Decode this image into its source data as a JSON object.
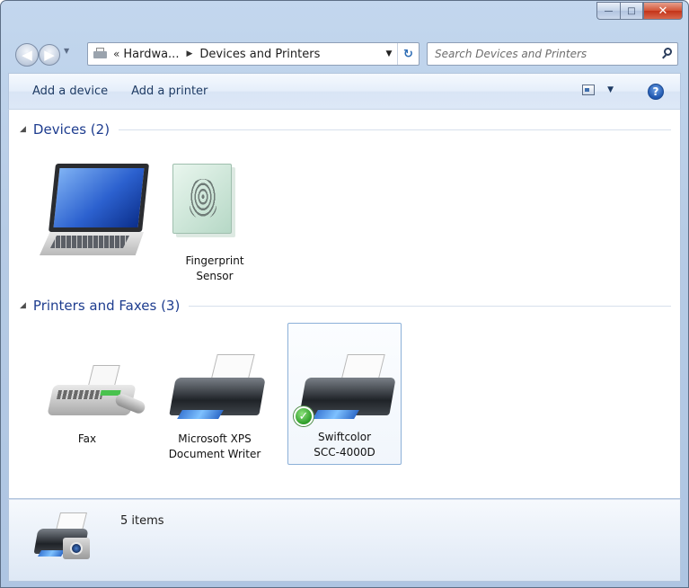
{
  "window": {
    "minimize_glyph": "—",
    "maximize_glyph": "□",
    "close_glyph": "✕"
  },
  "nav": {
    "back_glyph": "◀",
    "forward_glyph": "▶",
    "history_glyph": "▼"
  },
  "address_bar": {
    "prefix": "«",
    "crumbs": [
      "Hardwa...",
      "Devices and Printers"
    ],
    "separator": "▶",
    "dropdown_glyph": "▼",
    "refresh_glyph": "↻"
  },
  "search": {
    "placeholder": "Search Devices and Printers"
  },
  "command_bar": {
    "items": [
      "Add a device",
      "Add a printer"
    ],
    "view_dropdown_glyph": "▼",
    "help_glyph": "?"
  },
  "groups": [
    {
      "title": "Devices (2)",
      "caret": "◢",
      "items": [
        {
          "label": "",
          "icon": "laptop-icon"
        },
        {
          "label": "Fingerprint Sensor",
          "icon": "fingerprint-sensor-icon"
        }
      ]
    },
    {
      "title": "Printers and Faxes (3)",
      "caret": "◢",
      "items": [
        {
          "label": "Fax",
          "icon": "fax-icon"
        },
        {
          "label": "Microsoft XPS Document Writer",
          "icon": "printer-icon"
        },
        {
          "label": "Swiftcolor SCC-4000D",
          "icon": "printer-icon",
          "default": true,
          "selected": true
        }
      ]
    }
  ],
  "details": {
    "count": "5 items",
    "icon": "devices-and-printers-icon"
  },
  "colors": {
    "group_title": "#1e3d8f",
    "command_text": "#1e3b64",
    "selection_border": "#8cb0d8",
    "default_check": "#2d9c28"
  }
}
